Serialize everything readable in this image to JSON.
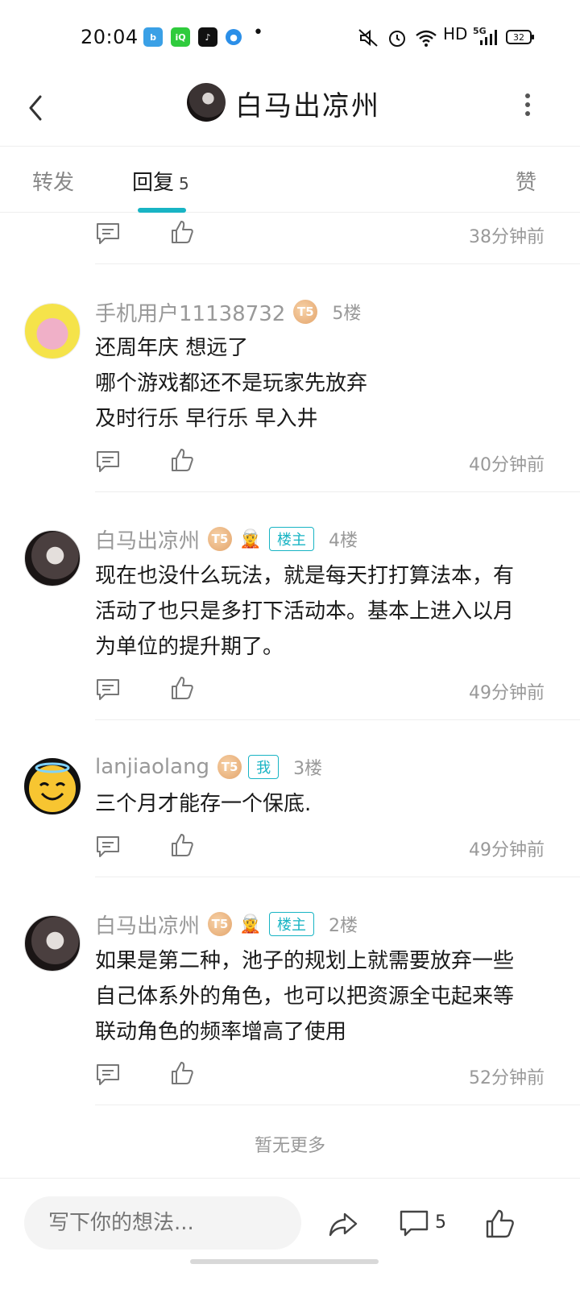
{
  "status_bar": {
    "time": "20:04",
    "apps": [
      "bilibili-icon",
      "iqiyi-icon",
      "tiktok-icon",
      "browser-icon"
    ],
    "hd_label": "HD",
    "network": "5G",
    "battery": "32"
  },
  "header": {
    "title": "白马出凉州"
  },
  "tabs": {
    "forward": "转发",
    "reply": "回复",
    "reply_count": "5",
    "likes": "赞"
  },
  "colors": {
    "accent": "#18b4c4",
    "muted": "#999999"
  },
  "first_row": {
    "time": "38分钟前"
  },
  "replies": [
    {
      "user": "手机用户11138732",
      "level": "T5",
      "floor": "5楼",
      "lines": [
        "还周年庆 想远了",
        "哪个游戏都还不是玩家先放弃",
        "及时行乐 早行乐 早入井"
      ],
      "time": "40分钟前"
    },
    {
      "user": "白马出凉州",
      "level": "T5",
      "tag": "楼主",
      "floor": "4楼",
      "lines": [
        "现在也没什么玩法，就是每天打打算法本，有",
        "活动了也只是多打下活动本。基本上进入以月",
        "为单位的提升期了。"
      ],
      "time": "49分钟前"
    },
    {
      "user": "lanjiaolang",
      "level": "T5",
      "tag": "我",
      "floor": "3楼",
      "lines": [
        "三个月才能存一个保底."
      ],
      "time": "49分钟前"
    },
    {
      "user": "白马出凉州",
      "level": "T5",
      "tag": "楼主",
      "floor": "2楼",
      "lines": [
        "如果是第二种，池子的规划上就需要放弃一些",
        "自己体系外的角色，也可以把资源全屯起来等",
        "联动角色的频率增高了使用"
      ],
      "time": "52分钟前"
    }
  ],
  "no_more": "暂无更多",
  "bottom_bar": {
    "input_placeholder": "写下你的想法...",
    "comment_count": "5"
  }
}
